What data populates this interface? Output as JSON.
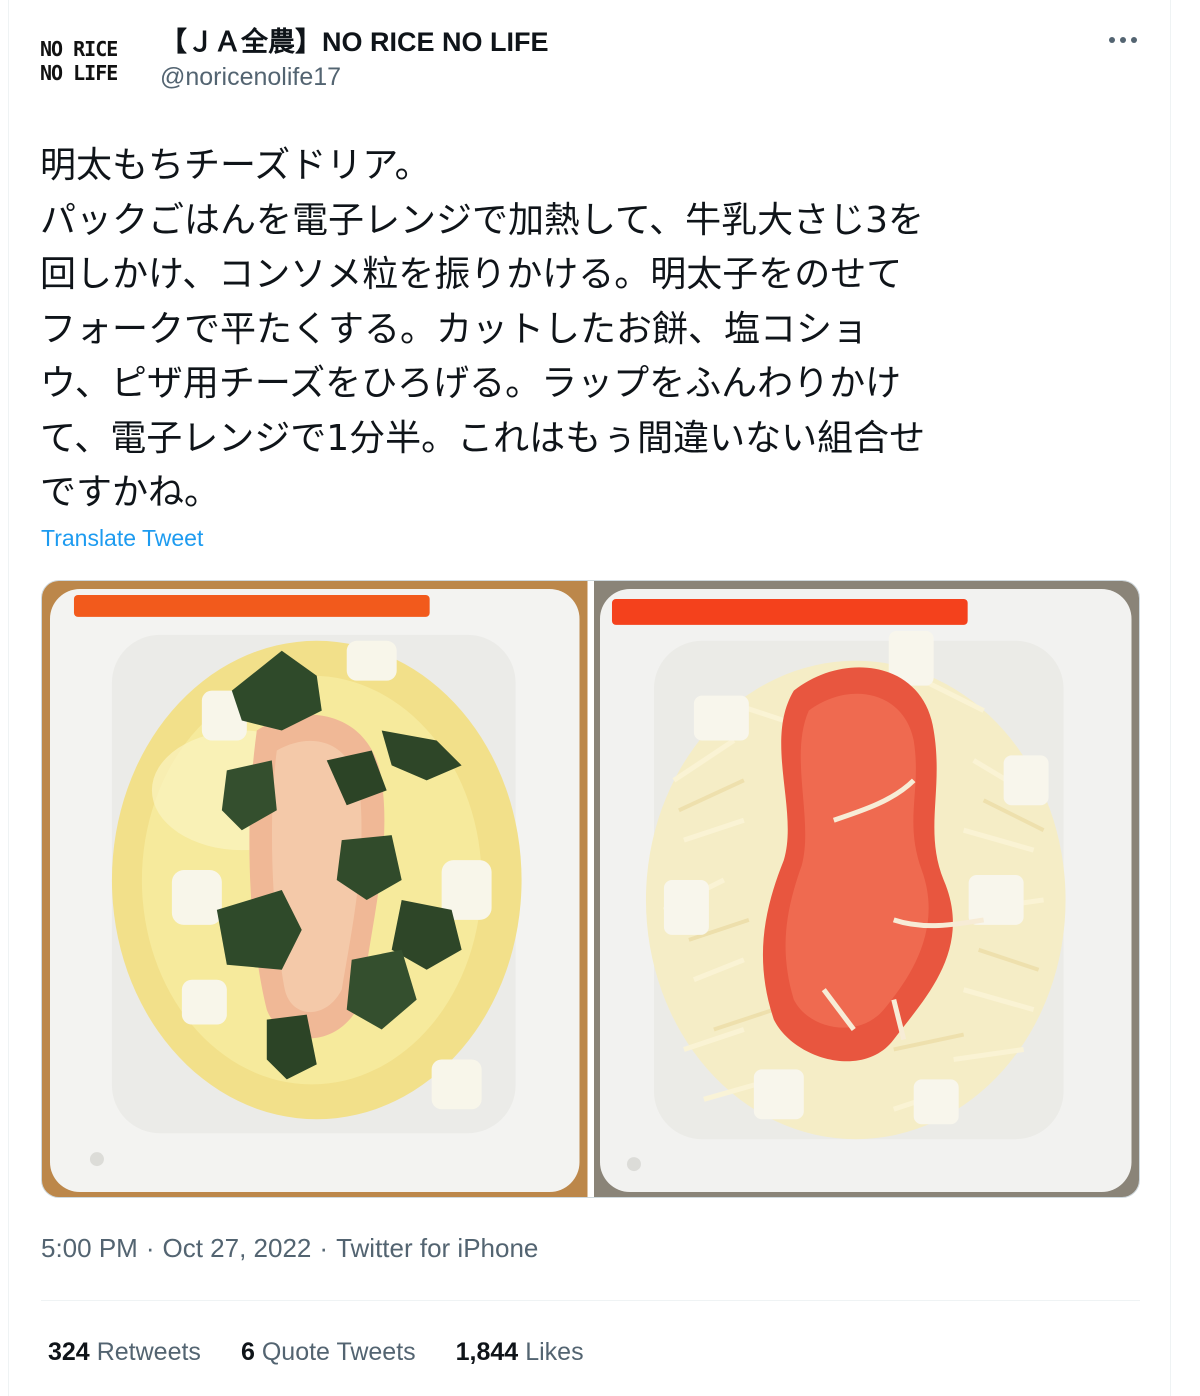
{
  "account": {
    "avatar_line1": "NO RICE",
    "avatar_line2": "NO LIFE",
    "display_name": "【ＪＡ全農】NO RICE NO LIFE",
    "handle": "@noricenolife17"
  },
  "tweet": {
    "text": "明太もちチーズドリア。\nパックごはんを電子レンジで加熱して、牛乳大さじ3を\n回しかけ、コンソメ粒を振りかける。明太子をのせて\nフォークで平たくする。カットしたお餅、塩コショ\nウ、ピザ用チーズをひろげる。ラップをふんわりかけ\nて、電子レンジで1分半。これはもぅ間違いない組合せ\nですかね。",
    "translate_label": "Translate Tweet",
    "time": "5:00 PM",
    "date": "Oct 27, 2022",
    "separator": "·",
    "source": "Twitter for iPhone"
  },
  "stats": {
    "retweets_count": "324",
    "retweets_label": "Retweets",
    "quotes_count": "6",
    "quotes_label": "Quote Tweets",
    "likes_count": "1,844",
    "likes_label": "Likes"
  },
  "colors": {
    "text": "#0f1419",
    "secondary": "#536471",
    "link": "#1d9bf0",
    "divider": "#eff3f4"
  },
  "icons": {
    "more": "more-horizontal-icon"
  }
}
